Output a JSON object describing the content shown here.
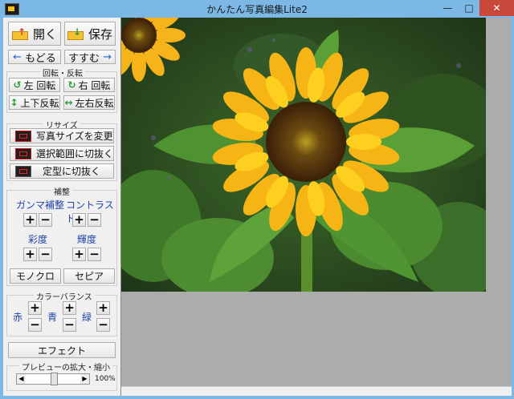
{
  "window": {
    "title": "かんたん写真編集Lite2",
    "minimize": "—",
    "maximize": "□",
    "close": "✕"
  },
  "file": {
    "open": "開く",
    "save": "保存"
  },
  "history": {
    "undo": "もどる",
    "redo": "すすむ"
  },
  "rotate": {
    "title": "回転・反転",
    "left": "左 回転",
    "right": "右 回転",
    "vflip": "上下反転",
    "hflip": "左右反転"
  },
  "resize": {
    "title": "リサイズ",
    "change_size": "写真サイズを変更",
    "crop_selection": "選択範囲に切抜く",
    "crop_shape": "定型に切抜く"
  },
  "correction": {
    "title": "補整",
    "gamma": "ガンマ補整",
    "contrast": "コントラスト",
    "saturation": "彩度",
    "brightness": "輝度",
    "plus": "+",
    "minus": "−",
    "mono": "モノクロ",
    "sepia": "セピア"
  },
  "color_balance": {
    "title": "カラーバランス",
    "red": "赤",
    "blue": "青",
    "green": "緑"
  },
  "effect": {
    "label": "エフェクト"
  },
  "preview": {
    "title": "プレビューの拡大・縮小",
    "zoom": "100%",
    "zoom_level": 0.5
  },
  "colors": {
    "titlebar": "#7bb8e6",
    "close": "#c9483b",
    "label_blue": "#2244aa",
    "viewer_bg": "#acacac"
  }
}
